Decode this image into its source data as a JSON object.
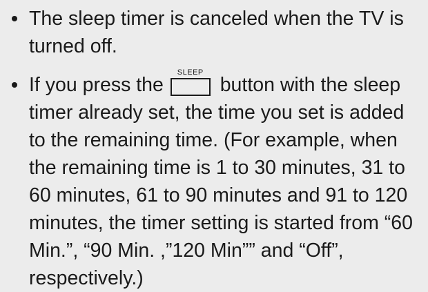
{
  "bullets": [
    {
      "text": "The sleep timer is canceled when the TV is turned off."
    },
    {
      "text_before": "If you press the ",
      "key_label": "SLEEP",
      "text_after": " button with the sleep timer already set, the time you set is added to the remaining time. (For example, when the remaining time is 1 to 30 minutes, 31 to 60 minutes, 61 to 90 minutes and 91 to 120 minutes, the timer setting is started from “60 Min.”, “90 Min. ,”120 Min”” and “Off”, respectively.)"
    }
  ]
}
